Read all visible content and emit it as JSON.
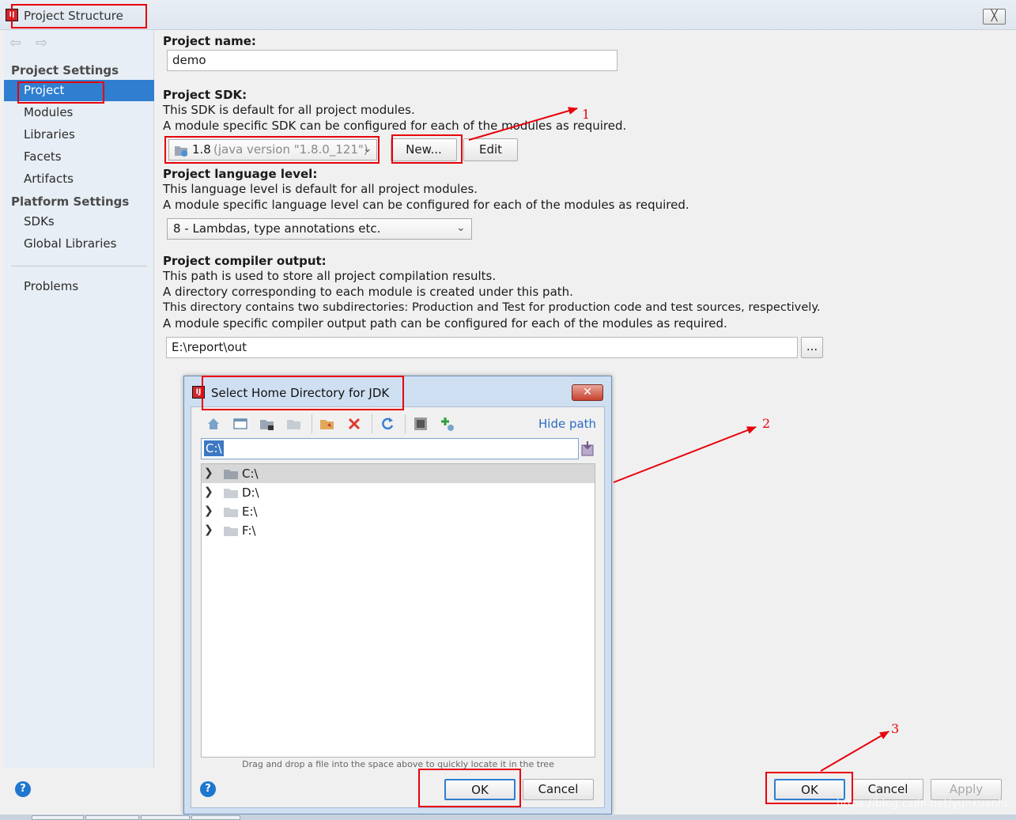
{
  "window": {
    "title": "Project Structure",
    "close_symbol": "╳",
    "logo_text": "IJ"
  },
  "sidebar": {
    "back_icon": "⇦",
    "forward_icon": "⇨",
    "project_settings_heading": "Project Settings",
    "project_settings_items": [
      "Project",
      "Modules",
      "Libraries",
      "Facets",
      "Artifacts"
    ],
    "platform_settings_heading": "Platform Settings",
    "platform_settings_items": [
      "SDKs",
      "Global Libraries"
    ],
    "problems": "Problems"
  },
  "project_name": {
    "label": "Project name:",
    "value": "demo"
  },
  "project_sdk": {
    "label": "Project SDK:",
    "desc_1": "This SDK is default for all project modules.",
    "desc_2": "A module specific SDK can be configured for each of the modules as required.",
    "sdk_version": "1.8",
    "sdk_detail": "(java version \"1.8.0_121\")",
    "new_button": "New...",
    "edit_button": "Edit"
  },
  "language_level": {
    "label": "Project language level:",
    "desc_1": "This language level is default for all project modules.",
    "desc_2": "A module specific language level can be configured for each of the modules as required.",
    "value": "8 - Lambdas, type annotations etc."
  },
  "compiler_output": {
    "label": "Project compiler output:",
    "desc_1": "This path is used to store all project compilation results.",
    "desc_2": "A directory corresponding to each module is created under this path.",
    "desc_3": "This directory contains two subdirectories: Production and Test for production code and test sources, respectively.",
    "desc_4": "A module specific compiler output path can be configured for each of the modules as required.",
    "value": "E:\\report\\out",
    "browse_button": "..."
  },
  "dialog": {
    "title": "Select Home Directory for JDK",
    "close_symbol": "✕",
    "hide_path": "Hide path",
    "path_value": "C:\\",
    "tree_items": [
      "C:\\",
      "D:\\",
      "E:\\",
      "F:\\"
    ],
    "drag_hint": "Drag and drop a file into the space above to quickly locate it in the tree",
    "ok_button": "OK",
    "cancel_button": "Cancel",
    "help": "?"
  },
  "footer": {
    "help": "?",
    "ok_button": "OK",
    "cancel_button": "Cancel",
    "apply_button": "Apply"
  },
  "annotations": {
    "marker_1": "1",
    "marker_2": "2",
    "marker_3": "3"
  },
  "watermark": "https://blog.csdn.net/yunxuanIu",
  "colors": {
    "annotation_red": "#e8000b",
    "selection_blue": "#2f7ed0",
    "link_blue": "#2b6cc4"
  }
}
